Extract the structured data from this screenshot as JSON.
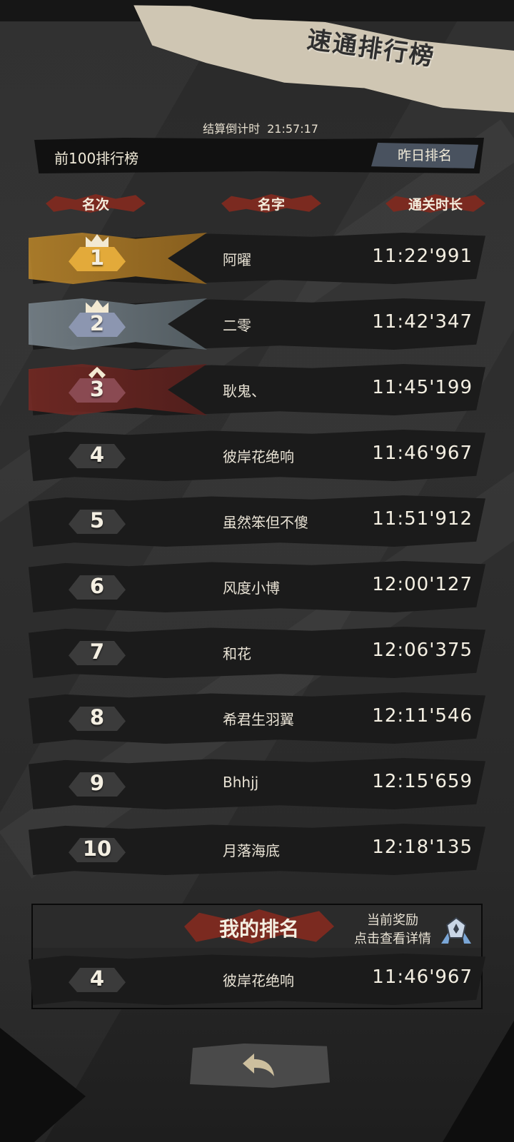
{
  "header": {
    "title": "速通排行榜",
    "countdown_label": "结算倒计时",
    "countdown_value": "21:57:17",
    "board_title": "前100排行榜",
    "yesterday_button": "昨日排名"
  },
  "columns": {
    "rank": "名次",
    "name": "名字",
    "time": "通关时长"
  },
  "leaderboard": [
    {
      "rank": "1",
      "name": "阿曜",
      "time": "11:22'991"
    },
    {
      "rank": "2",
      "name": "二零",
      "time": "11:42'347"
    },
    {
      "rank": "3",
      "name": "耿鬼、",
      "time": "11:45'199"
    },
    {
      "rank": "4",
      "name": "彼岸花绝响",
      "time": "11:46'967"
    },
    {
      "rank": "5",
      "name": "虽然笨但不傻",
      "time": "11:51'912"
    },
    {
      "rank": "6",
      "name": "风度小博",
      "time": "12:00'127"
    },
    {
      "rank": "7",
      "name": "和花",
      "time": "12:06'375"
    },
    {
      "rank": "8",
      "name": "希君生羽翼",
      "time": "12:11'546"
    },
    {
      "rank": "9",
      "name": "Bhhjj",
      "time": "12:15'659"
    },
    {
      "rank": "10",
      "name": "月落海底",
      "time": "12:18'135"
    }
  ],
  "my_rank": {
    "title": "我的排名",
    "reward_line1": "当前奖励",
    "reward_line2": "点击查看详情",
    "rank": "4",
    "name": "彼岸花绝响",
    "time": "11:46'967"
  },
  "colors": {
    "gold": "#e3aa3a",
    "silver": "#8c96b0",
    "bronze": "#8a4a52",
    "accent_red": "#7b2a20"
  },
  "icons": {
    "back": "back-arrow-icon",
    "reward": "reward-medal-icon"
  }
}
